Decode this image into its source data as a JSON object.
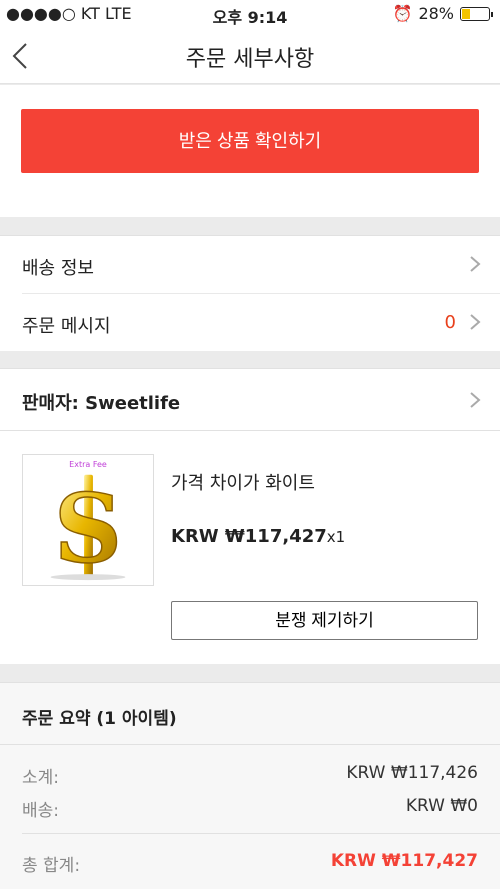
{
  "status_bar": {
    "carrier": "●●●●○ KT   LTE",
    "time": "오후 9:14",
    "battery": "28%",
    "battery_level": 0.28
  },
  "header": {
    "title": "주문 세부사항"
  },
  "actions": {
    "confirm_label": "받은 상품 확인하기"
  },
  "info": {
    "shipping_label": "배송 정보",
    "message_label": "주문 메시지",
    "message_count": "0"
  },
  "seller": {
    "label": "판매자: Sweetlife"
  },
  "product": {
    "image_tag": "Extra Fee",
    "name": "가격 차이가 화이트",
    "price": "KRW ₩117,427",
    "qty": "x1",
    "dispute_label": "분쟁 제기하기"
  },
  "summary": {
    "title": "주문 요약 (1 아이템)",
    "subtotal_label": "소계:",
    "subtotal_value": "KRW ₩117,426",
    "shipping_label": "배송:",
    "shipping_value": "KRW ₩0",
    "total_label": "총 합계:",
    "total_value": "KRW ₩117,427"
  },
  "colors": {
    "accent": "#f44236",
    "count": "#e8401c"
  }
}
